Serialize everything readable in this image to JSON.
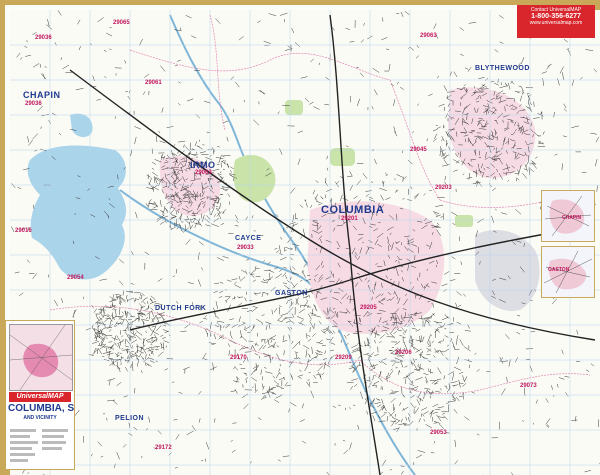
{
  "map": {
    "place_labels": [
      {
        "name": "COLUMBIA",
        "zip": "29201"
      },
      {
        "name": "IRMO",
        "zip": "29063"
      },
      {
        "name": "CHAPIN",
        "zip": "29036"
      },
      {
        "name": "DUTCH FORK",
        "zip": ""
      },
      {
        "name": "GASTON",
        "zip": ""
      },
      {
        "name": "PELION",
        "zip": ""
      },
      {
        "name": "BLYTHEWOOD",
        "zip": ""
      },
      {
        "name": "CAYCE",
        "zip": "29033"
      }
    ],
    "zip_labels": [
      "29065",
      "29036",
      "29063",
      "29061",
      "29016",
      "29045",
      "29054",
      "29203",
      "29205",
      "29206",
      "29209",
      "29170",
      "29172",
      "29073",
      "29053"
    ],
    "colors": {
      "roads": "#333333",
      "water": "#a9d4ea",
      "parks": "#c9e3a9",
      "urban": "#f0c9d6",
      "frame": "#c9a85a",
      "zip_lines": "#e085b3"
    }
  },
  "contact": {
    "lines": [
      "Contact UniversalMAP",
      "1-800-356-6277",
      "www.universalmap.com"
    ]
  },
  "insets": [
    {
      "label": "CHAPIN"
    },
    {
      "label": "GASTON"
    }
  ],
  "legend_panel": {
    "brand": "UniversalMAP",
    "title": "COLUMBIA, SC",
    "subtitle": "AND VICINITY"
  }
}
